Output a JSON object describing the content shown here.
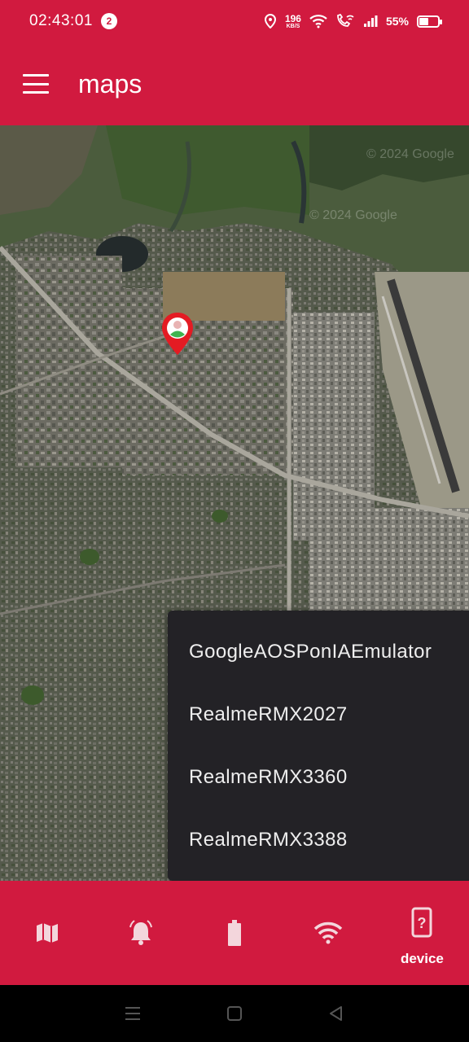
{
  "status_bar": {
    "time": "02:43:01",
    "notification_count": "2",
    "net_speed": "196",
    "net_unit": "KB/S",
    "battery_percent": "55%",
    "battery_level": 0.55
  },
  "app_bar": {
    "title": "maps"
  },
  "map": {
    "watermark_1": "© 2024 Google",
    "watermark_2": "© 2024 Google",
    "marker_icon": "location-pin-icon"
  },
  "device_menu": {
    "items": [
      "GoogleAOSPonIAEmulator",
      "RealmeRMX2027",
      "RealmeRMX3360",
      "RealmeRMX3388"
    ]
  },
  "bottom_nav": {
    "items": [
      {
        "icon": "map-icon",
        "label": ""
      },
      {
        "icon": "bell-icon",
        "label": ""
      },
      {
        "icon": "battery-icon",
        "label": ""
      },
      {
        "icon": "wifi-icon",
        "label": ""
      },
      {
        "icon": "device-unknown-icon",
        "label": "device",
        "active": true
      }
    ]
  },
  "colors": {
    "primary": "#d11a3f",
    "menu_bg": "#232226",
    "menu_text": "#eeeeee"
  }
}
